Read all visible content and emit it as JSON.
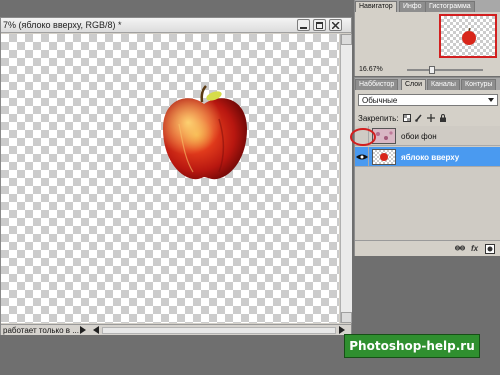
{
  "document": {
    "title": "7% (яблоко вверху, RGB/8) *",
    "status_text": "работает только в ..."
  },
  "navigator": {
    "tabs": [
      "Навигатор",
      "Инфо",
      "Гистограмма"
    ],
    "zoom": "16.67%"
  },
  "layers": {
    "tabs": [
      "Наббистор",
      "Слои",
      "Каналы",
      "Контуры"
    ],
    "blend_mode": "Обычные",
    "lock_label": "Закрепить:",
    "items": [
      {
        "name": "обои фон",
        "visible": false,
        "selected": false
      },
      {
        "name": "яблоко вверху",
        "visible": true,
        "selected": true
      }
    ]
  },
  "watermark": "Photoshop-help.ru",
  "colors": {
    "selection": "#4a9af0",
    "highlight": "#d21f1f",
    "watermark_bg": "#2f8f2f"
  }
}
